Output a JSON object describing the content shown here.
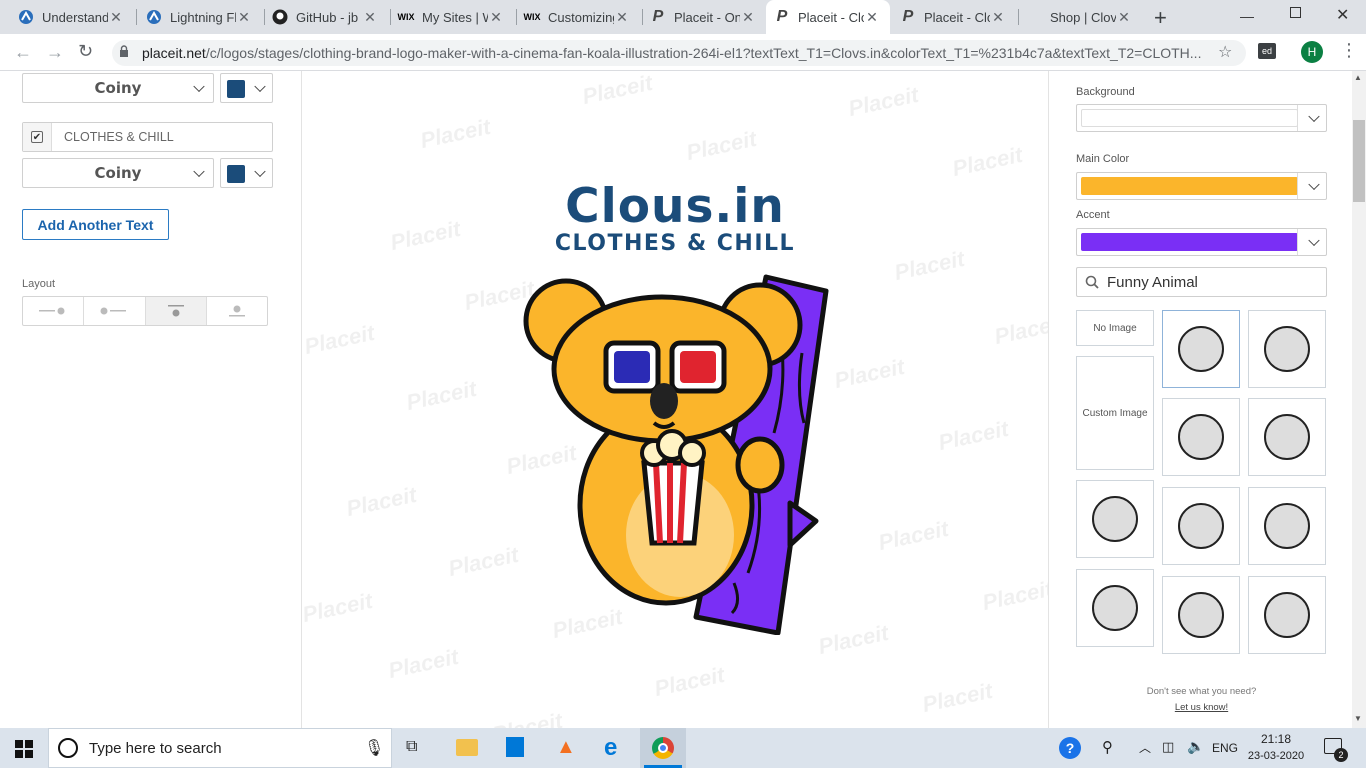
{
  "browser": {
    "tabs": [
      {
        "title": "Understand",
        "icon": "appian-icon"
      },
      {
        "title": "Lightning Fl",
        "icon": "appian-icon"
      },
      {
        "title": "GitHub - jb",
        "icon": "github-icon"
      },
      {
        "title": "My Sites | W",
        "icon": "wix-icon"
      },
      {
        "title": "Customizing",
        "icon": "wix-icon"
      },
      {
        "title": "Placeit - On",
        "icon": "placeit-icon"
      },
      {
        "title": "Placeit - Clo",
        "icon": "placeit-icon"
      },
      {
        "title": "Placeit - Clo",
        "icon": "placeit-icon"
      },
      {
        "title": "Shop | Clov",
        "icon": "blank-icon"
      }
    ],
    "url_host": "placeit.net",
    "url_path": "/c/logos/stages/clothing-brand-logo-maker-with-a-cinema-fan-koala-illustration-264i-el1?textText_T1=Clovs.in&colorText_T1=%231b4c7a&textText_T2=CLOTH...",
    "profile_initial": "H",
    "ext_label": "ed"
  },
  "left_panel": {
    "font1": "Coiny",
    "text2_value": "CLOTHES & CHILL",
    "text2_checked": true,
    "font2": "Coiny",
    "text_color": "#1b4c7a",
    "add_text_label": "Add Another Text",
    "layout_label": "Layout"
  },
  "canvas": {
    "brand_name": "Clous.in",
    "tagline": "CLOTHES & CHILL",
    "watermark": "Placeit"
  },
  "right_panel": {
    "background_label": "Background",
    "main_color_label": "Main Color",
    "main_color": "#fbb52b",
    "accent_label": "Accent",
    "accent_color": "#7a2ff5",
    "search_value": "Funny Animal",
    "no_image_label": "No Image",
    "custom_image_label": "Custom Image",
    "help_text": "Don't see what you need?",
    "help_link": "Let us know!"
  },
  "taskbar": {
    "search_placeholder": "Type here to search",
    "language": "ENG",
    "time": "21:18",
    "date": "23-03-2020",
    "notifications": "2"
  }
}
